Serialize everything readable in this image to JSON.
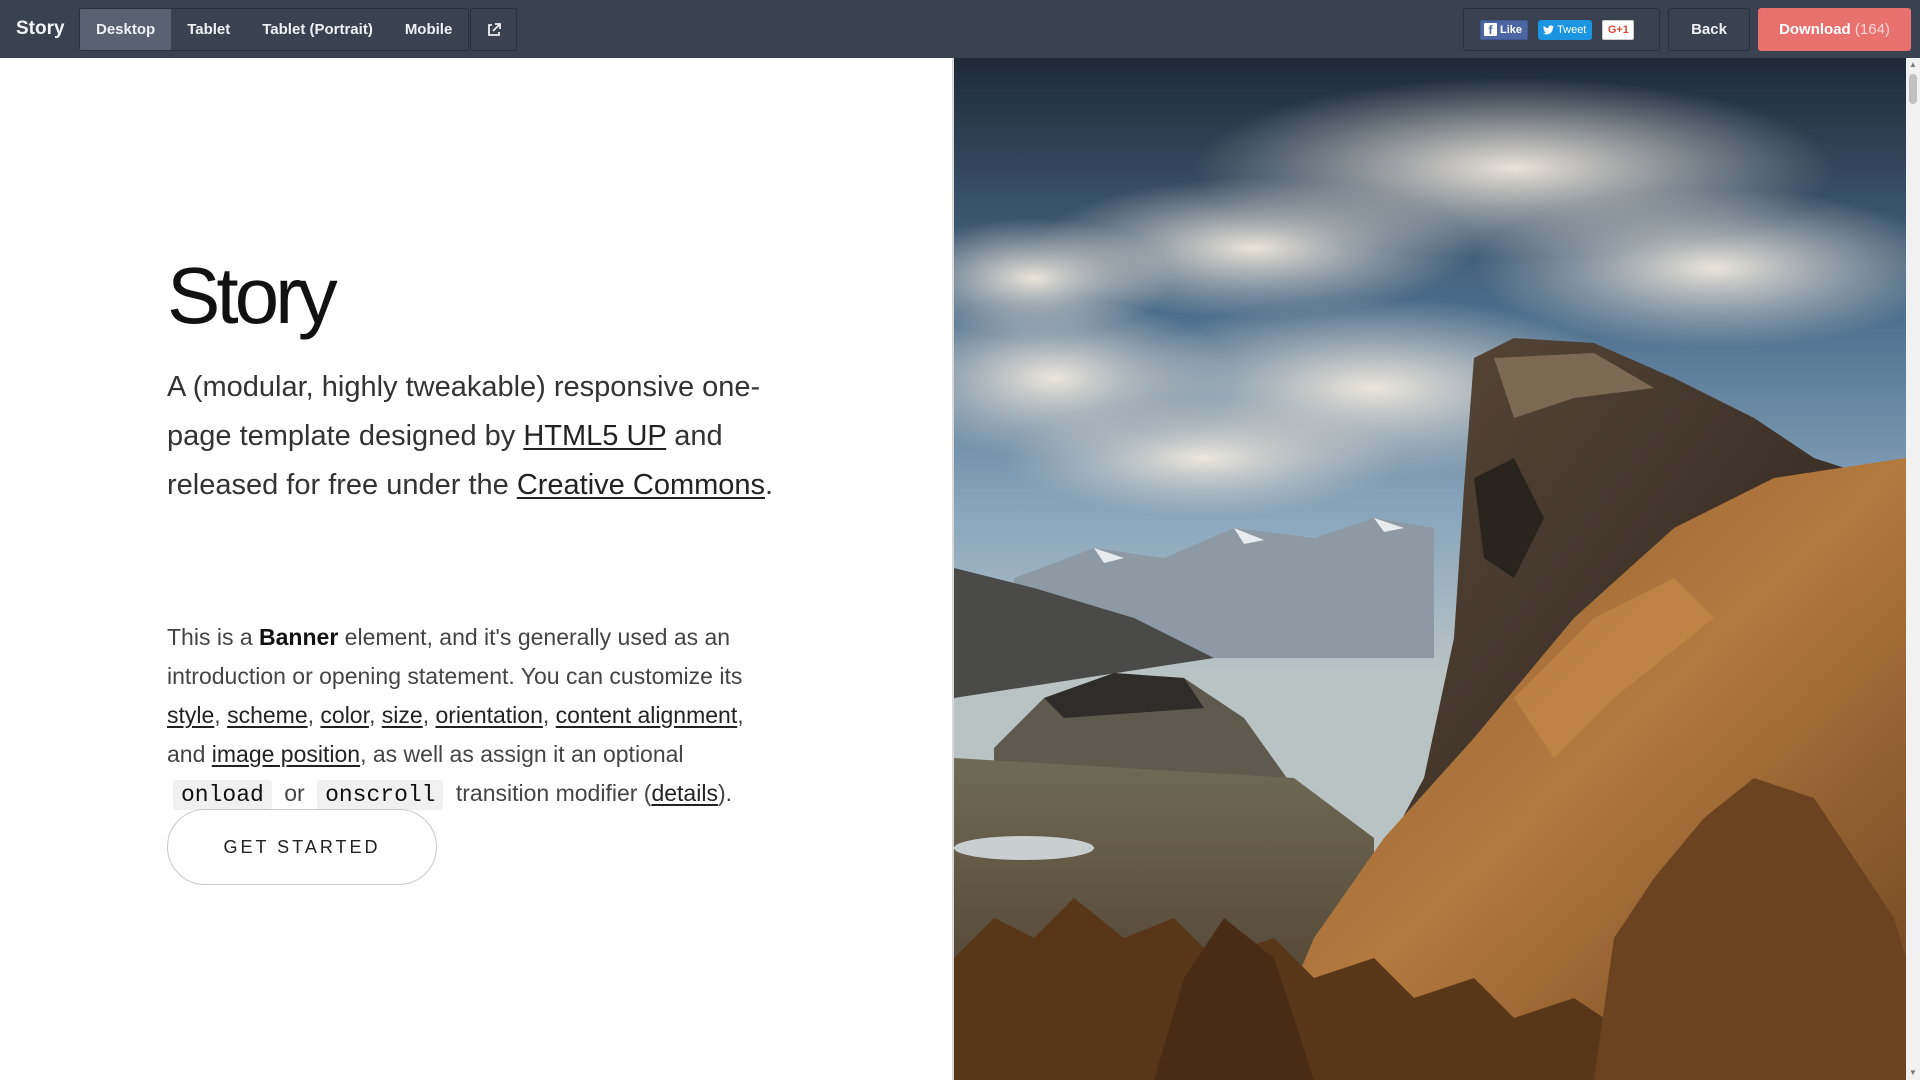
{
  "topbar": {
    "brand": "Story",
    "devices": [
      "Desktop",
      "Tablet",
      "Tablet (Portrait)",
      "Mobile"
    ],
    "active_device": "Desktop",
    "social": {
      "like": "Like",
      "tweet": "Tweet",
      "gplus": "G+1"
    },
    "back_label": "Back",
    "download_label": "Download",
    "download_count": "(164)"
  },
  "banner": {
    "title": "Story",
    "lead": {
      "before_link1": "A (modular, highly tweakable) responsive one-page template designed by ",
      "link1": "HTML5 UP",
      "between": " and released for free under the ",
      "link2": "Creative Commons",
      "after": "."
    },
    "body": {
      "t1": "This is a ",
      "bold": "Banner",
      "t2": " element, and it's generally used as an introduction or opening statement. You can customize its ",
      "link_style": "style",
      "link_scheme": "scheme",
      "link_color": "color",
      "link_size": "size",
      "link_orientation": "orientation",
      "link_content_alignment": "content alignment",
      "t3": ", and ",
      "link_image_position": "image position",
      "t4": ", as well as assign it an optional ",
      "code_onload": "onload",
      "t5": " or ",
      "code_onscroll": "onscroll",
      "t6": " transition modifier (",
      "link_details": "details",
      "t7": ")."
    },
    "cta_label": "GET STARTED"
  },
  "colors": {
    "topbar_bg": "#3a4250",
    "download_bg": "#e8706d"
  },
  "icons": {
    "external_link": "external-link-icon",
    "facebook": "facebook-icon",
    "twitter": "twitter-icon"
  }
}
